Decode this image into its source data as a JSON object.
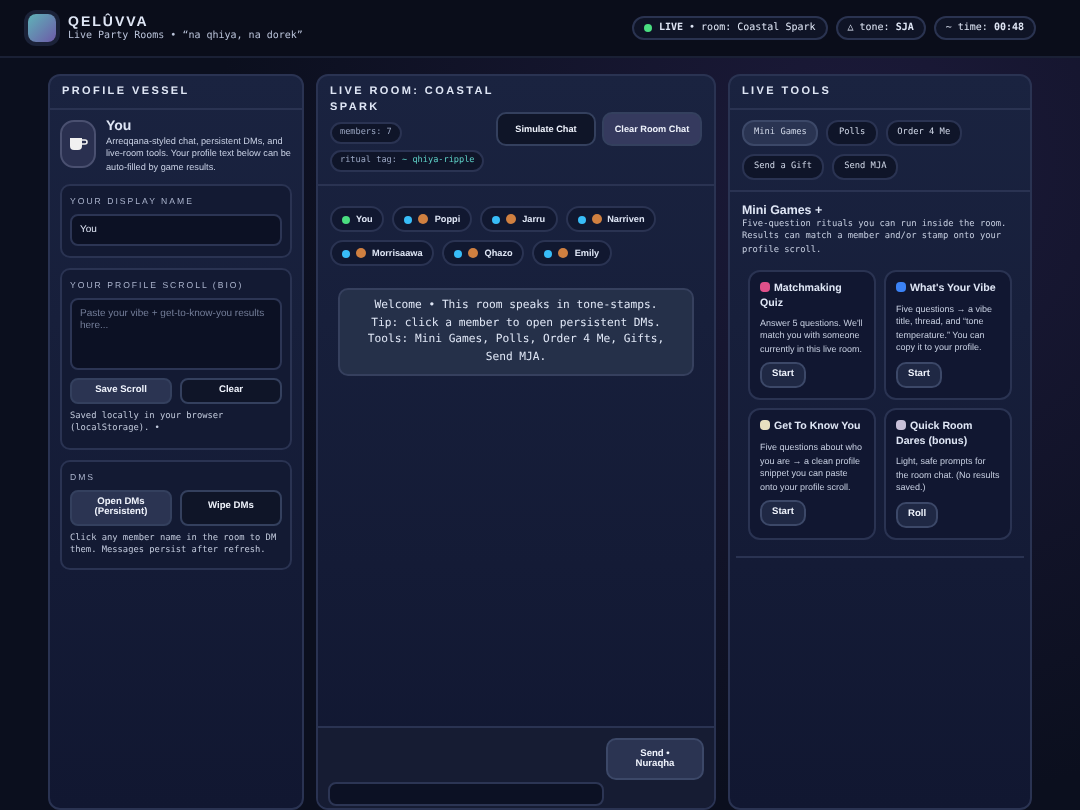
{
  "header": {
    "brand": "QELÛVVA",
    "subtitle": "Live Party Rooms • “na qhiya, na dorek”",
    "pills": [
      {
        "kind": "live",
        "label": "LIVE",
        "text": "• room: Coastal Spark"
      },
      {
        "kind": "plain",
        "glyph": "△",
        "label": "tone:",
        "value": "SJA"
      },
      {
        "kind": "plain",
        "glyph": "~",
        "label": "time:",
        "value": "00:48"
      }
    ]
  },
  "profile": {
    "title": "PROFILE VESSEL",
    "name": "You",
    "blurb": "Arreqqana-styled chat, persistent DMs, and live-room tools. Your profile text below can be auto-filled by game results.",
    "display_name": {
      "label": "YOUR DISPLAY NAME",
      "value": "You"
    },
    "bio": {
      "label": "YOUR PROFILE SCROLL (BIO)",
      "placeholder": "Paste your vibe + get-to-know-you results here...",
      "buttons": [
        {
          "label": "Save Scroll",
          "primary": true
        },
        {
          "label": "Clear",
          "primary": false
        }
      ],
      "note": "Saved locally in your browser (localStorage). •"
    },
    "dms": {
      "label": "DMS",
      "buttons": [
        {
          "label": "Open DMs (Persistent)",
          "primary": true
        },
        {
          "label": "Wipe DMs",
          "primary": false
        }
      ],
      "note": "Click any member name in the room to DM them. Messages persist after refresh."
    }
  },
  "room": {
    "title": "LIVE ROOM: COASTAL SPARK",
    "members_count": "members: 7",
    "ritual_tag": "ritual tag: ~ qhiya-ripple",
    "buttons": [
      {
        "label": "Simulate Chat",
        "primary": false
      },
      {
        "label": "Clear Room Chat",
        "primary": true
      }
    ],
    "members": [
      {
        "name": "You",
        "color": "#4ade80",
        "has_icon": false
      },
      {
        "name": "Poppi",
        "color": "#38bdf8",
        "has_icon": true
      },
      {
        "name": "Jarru",
        "color": "#38bdf8",
        "has_icon": true
      },
      {
        "name": "Narriven",
        "color": "#38bdf8",
        "has_icon": true
      },
      {
        "name": "Morrisaawa",
        "color": "#38bdf8",
        "has_icon": true
      },
      {
        "name": "Qhazo",
        "color": "#38bdf8",
        "has_icon": true
      },
      {
        "name": "Emily",
        "color": "#38bdf8",
        "has_icon": true
      }
    ],
    "welcome": [
      "Welcome • This room speaks in tone-stamps.",
      "Tip: click a member to open persistent DMs.",
      "Tools: Mini Games, Polls, Order 4 Me, Gifts, Send MJA."
    ],
    "send_button": "Send • Nuraqha"
  },
  "tools": {
    "title": "LIVE TOOLS",
    "tabs": [
      {
        "label": "Mini Games",
        "selected": true
      },
      {
        "label": "Polls",
        "selected": false
      },
      {
        "label": "Order 4 Me",
        "selected": false
      },
      {
        "label": "Send a Gift",
        "selected": false
      },
      {
        "label": "Send MJA",
        "selected": false
      }
    ],
    "section_title": "Mini Games +",
    "section_text": "Five-question rituals you can run inside the room. Results can match a member and/or stamp onto your profile scroll.",
    "games": [
      {
        "title": "Matchmaking Quiz",
        "text": "Answer 5 questions. We'll match you with someone currently in this live room.",
        "button": "Start"
      },
      {
        "title": "What's Your Vibe",
        "text": "Five questions → a vibe title, thread, and “tone temperature.” You can copy it to your profile.",
        "button": "Start"
      },
      {
        "title": "Get To Know You",
        "text": "Five questions about who you are → a clean profile snippet you can paste onto your profile scroll.",
        "button": "Start"
      },
      {
        "title": "Quick Room Dares (bonus)",
        "text": "Light, safe prompts for the room chat. (No results saved.)",
        "button": "Roll"
      }
    ]
  }
}
